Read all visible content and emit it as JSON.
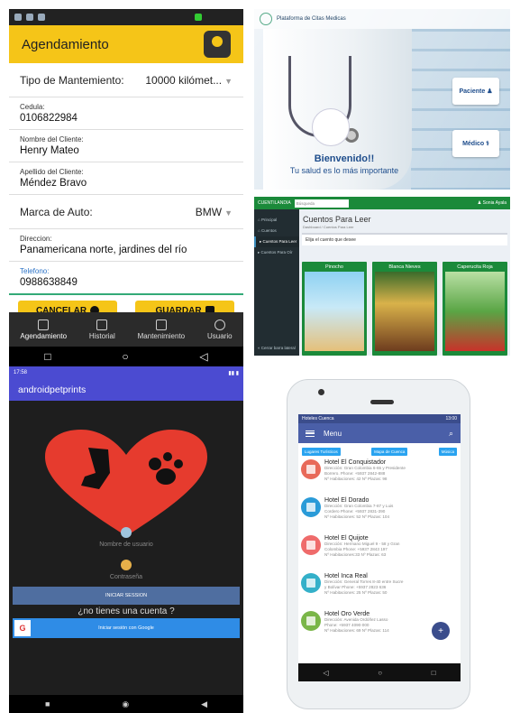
{
  "agendamiento": {
    "title": "Agendamiento",
    "tipo_label": "Tipo de Mantemiento:",
    "tipo_value": "10000 kilómet...",
    "cedula_label": "Cedula:",
    "cedula_value": "0106822984",
    "nombre_label": "Nombre del Cliente:",
    "nombre_value": "Henry Mateo",
    "apellido_label": "Apellido del Cliente:",
    "apellido_value": "Méndez Bravo",
    "marca_label": "Marca de Auto:",
    "marca_value": "BMW",
    "direccion_label": "Direccion:",
    "direccion_value": "Panamericana norte, jardines del río",
    "telefono_label": "Telefono:",
    "telefono_value": "0988638849",
    "cancel_label": "CANCELAR",
    "save_label": "GUARDAR",
    "nav": [
      "Agendamiento",
      "Historial",
      "Mantenimiento",
      "Usuario"
    ],
    "sysnav": [
      "□",
      "○",
      "◁"
    ]
  },
  "citas": {
    "brand": "Plataforma de Citas Medicas",
    "welcome": "Bienvenido!!",
    "tagline": "Tu salud es lo más importante",
    "paciente": "Paciente ♟",
    "medico": "Médico ⚕"
  },
  "cuentos": {
    "brand": "CUENTILANDIA",
    "search": "Búsqueda",
    "user": "♟ Sonia Ayala",
    "menu": [
      "Principal",
      "Cuentos",
      "Cuentos Para Leer",
      "Cuentos Para Oír"
    ],
    "menu_bottom": "Cerrar barra lateral",
    "title": "Cuentos Para Leer",
    "crumb": "Dashboard / Cuentos Para Leer",
    "prompt": "Elija el cuento que desee",
    "cards": [
      "Pinocho",
      "Blanca Nieves",
      "Caperucita Roja"
    ]
  },
  "pet": {
    "time": "17:58",
    "app_title": "androidpetprints",
    "user_label": "Nombre de usuario",
    "pass_label": "Contraseña",
    "login": "INICIAR SESSION",
    "question": "¿no tienes una cuenta ?",
    "google": "Iniciar sesión con Google",
    "sysnav": [
      "■",
      "◉",
      "◀"
    ]
  },
  "hoteles": {
    "status_left": "Hoteles Cuenca",
    "status_right": "13:00",
    "menu": "Menu",
    "chips": [
      "Lugares Turísticos",
      "Mapa de Cuenca",
      "Música"
    ],
    "items": [
      {
        "name": "Hotel El Conquistador",
        "d1": "Dirección: Gran Colombia 6-65 y Presidente",
        "d2": "Borrero. Phone: +5937 2842-888",
        "d3": "Nº Habitaciones: 42 Nº Plazas: 98",
        "color": "#e86a5a"
      },
      {
        "name": "Hotel El Dorado",
        "d1": "Dirección: Gran Colombia 7-87 y Luis",
        "d2": "Cordero Phone: +5937 2831-390",
        "d3": "Nº Habitaciones: 52 Nº Plazas: 104",
        "color": "#2a9bd8"
      },
      {
        "name": "Hotel El Quijote",
        "d1": "Dirección: Hermano Miguel 9 - 58 y Gran",
        "d2": "Colombia Phone: +5937 2843 197",
        "d3": "Nº Habitaciones:33 Nº Plazas: 63",
        "color": "#ef6b6b"
      },
      {
        "name": "Hotel Inca Real",
        "d1": "Dirección: General Torres 8-40 entre Sucre",
        "d2": "y Bolívar Phone: +5937 2823 636",
        "d3": "Nº Habitaciones: 25 Nº Plazas: 50",
        "color": "#34b0c9"
      },
      {
        "name": "Hotel Oro Verde",
        "d1": "Dirección: Avenida Ordóñez Lasso",
        "d2": "Phone: +5937 4090-000",
        "d3": "Nº Habitaciones: 69 Nº Plazas: 114",
        "color": "#7ab648"
      }
    ],
    "fab": "+",
    "sysnav": [
      "◁",
      "○",
      "□"
    ]
  }
}
